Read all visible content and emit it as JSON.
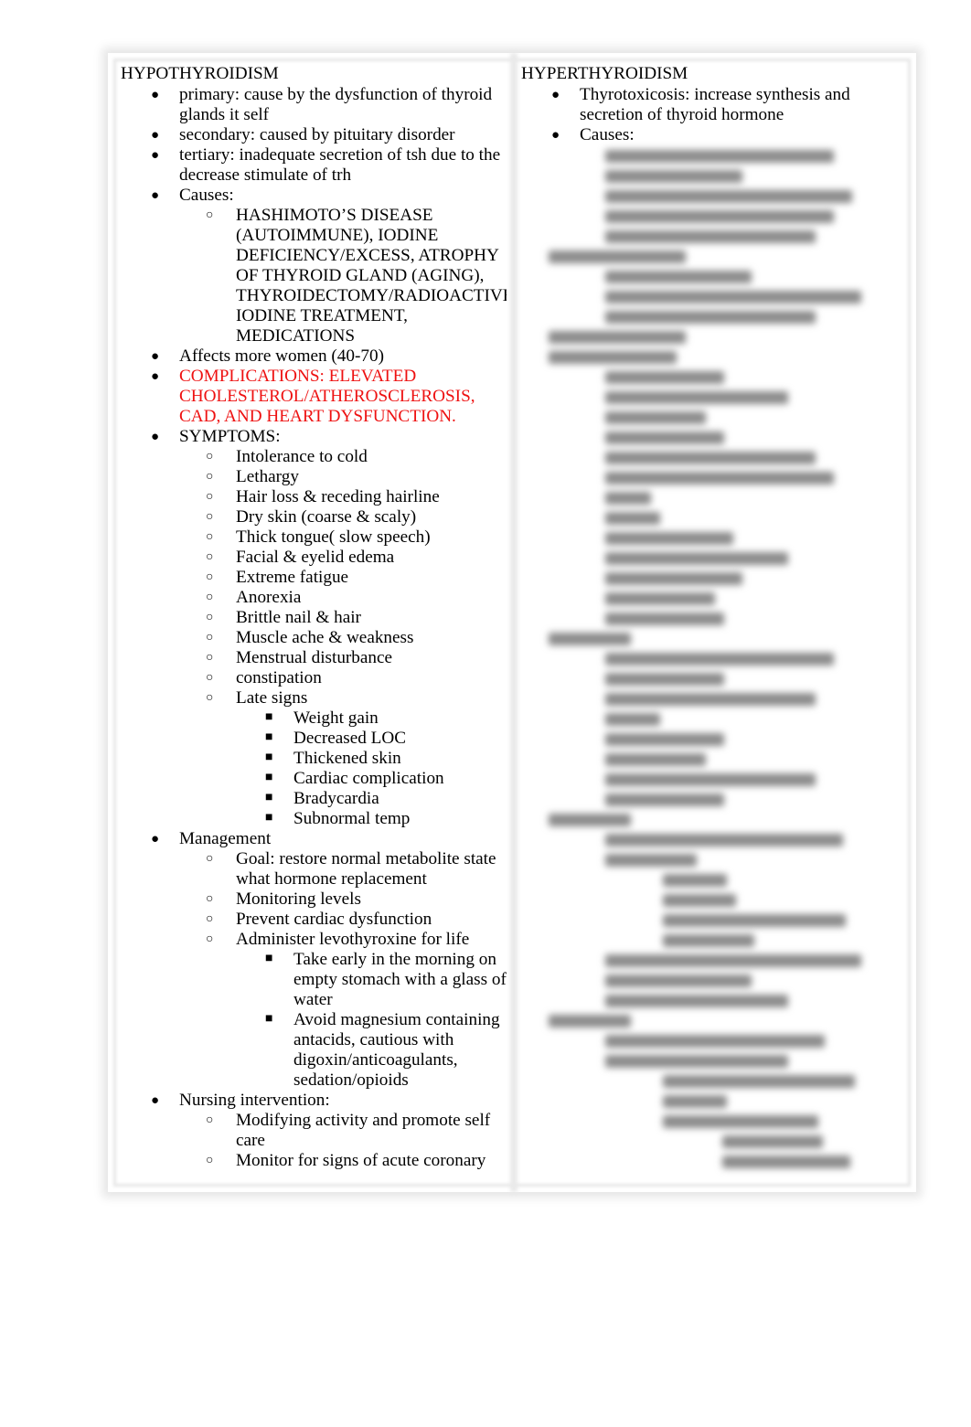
{
  "left": {
    "title": "HYPOTHYROIDISM",
    "items": [
      {
        "text": "primary: cause by the dysfunction of thyroid glands it self"
      },
      {
        "text": "secondary:  caused by pituitary disorder"
      },
      {
        "text": "tertiary: inadequate secretion of tsh due to the decrease stimulate of trh"
      },
      {
        "text": "Causes:",
        "children": [
          {
            "text": "HASHIMOTO’S DISEASE (AUTOIMMUNE), IODINE DEFICIENCY/EXCESS, ATROPHY OF THYROID GLAND (AGING), THYROIDECTOMY/RADIOACTIVE IODINE TREATMENT, MEDICATIONS"
          }
        ]
      },
      {
        "text": "Affects more women (40-70)"
      },
      {
        "text": "COMPLICATIONS: ELEVATED CHOLESTEROL/ATHEROSCLEROSIS, CAD, AND HEART DYSFUNCTION.",
        "color": "#ee1111"
      },
      {
        "text": "SYMPTOMS:",
        "children": [
          {
            "text": "Intolerance to cold"
          },
          {
            "text": "Lethargy"
          },
          {
            "text": "Hair loss & receding hairline"
          },
          {
            "text": "Dry skin (coarse & scaly)"
          },
          {
            "text": "Thick tongue( slow speech)"
          },
          {
            "text": "Facial & eyelid edema"
          },
          {
            "text": "Extreme fatigue"
          },
          {
            "text": "Anorexia"
          },
          {
            "text": "Brittle nail & hair"
          },
          {
            "text": "Muscle ache & weakness"
          },
          {
            "text": "Menstrual disturbance"
          },
          {
            "text": "constipation"
          },
          {
            "text": "Late signs",
            "children": [
              {
                "text": "Weight gain"
              },
              {
                "text": "Decreased LOC"
              },
              {
                "text": "Thickened skin"
              },
              {
                "text": "Cardiac complication"
              },
              {
                "text": "Bradycardia"
              },
              {
                "text": "Subnormal temp"
              }
            ]
          }
        ]
      },
      {
        "text": "Management",
        "children": [
          {
            "text": "Goal: restore normal metabolite state what hormone replacement"
          },
          {
            "text": "Monitoring levels"
          },
          {
            "text": "Prevent cardiac dysfunction"
          },
          {
            "text": "Administer levothyroxine for life",
            "children": [
              {
                "text": "Take early in the morning on empty stomach with a glass of water"
              },
              {
                "text": "Avoid magnesium containing antacids, cautious with digoxin/anticoagulants, sedation/opioids"
              }
            ]
          }
        ]
      },
      {
        "text": "Nursing intervention:",
        "children": [
          {
            "text": "Modifying activity and promote self care"
          },
          {
            "text": "Monitor for signs of acute coronary"
          }
        ]
      }
    ]
  },
  "right": {
    "title": "HYPERTHYROIDISM",
    "items": [
      {
        "text": "Thyrotoxicosis: increase synthesis and secretion of thyroid hormone"
      },
      {
        "text": "Causes:"
      }
    ],
    "blurred_notice": "content blurred"
  },
  "bullets": {
    "level1": "●",
    "level2": "○",
    "level3": "■"
  }
}
